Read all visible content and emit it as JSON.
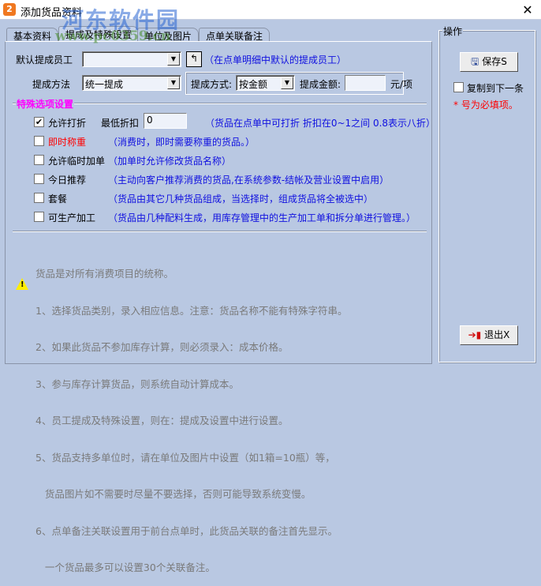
{
  "window": {
    "title": "添加货品资料",
    "close": "✕"
  },
  "watermark": {
    "name": "河东软件园",
    "url": "www.pc0359.cn"
  },
  "tabs": [
    {
      "label": "基本资料"
    },
    {
      "label": "提成及特殊设置"
    },
    {
      "label": "单位及图片"
    },
    {
      "label": "点单关联备注"
    }
  ],
  "commission": {
    "default_employee_label": "默认提成员工",
    "default_employee_value": "",
    "default_employee_hint": "（在点单明细中默认的提成员工）",
    "method_label": "提成方法",
    "method_value": "统一提成",
    "mode_label": "提成方式:",
    "mode_value": "按金额",
    "amount_label": "提成金额:",
    "amount_value": "",
    "amount_unit": "元/项"
  },
  "special": {
    "title": "特殊选项设置",
    "min_discount_label": "最低折扣",
    "min_discount_value": "0",
    "options": [
      {
        "label": "允许打折",
        "checked": true,
        "hint": "（货品在点单中可打折 折扣在0~1之间 0.8表示八折）"
      },
      {
        "label": "即时称重",
        "checked": false,
        "hint": "（消费时，即时需要称重的货品。）"
      },
      {
        "label": "允许临时加单",
        "checked": false,
        "hint": "（加单时允许修改货品名称）"
      },
      {
        "label": "今日推荐",
        "checked": false,
        "hint": "（主动向客户推荐消费的货品,在系统参数-结帐及营业设置中启用）"
      },
      {
        "label": "套餐",
        "checked": false,
        "hint": "（货品由其它几种货品组成，当选择时，组成货品将全被选中）"
      },
      {
        "label": "可生产加工",
        "checked": false,
        "hint": "（货品由几种配料生成，用库存管理中的生产加工单和拆分单进行管理。）"
      }
    ]
  },
  "notes": [
    "货品是对所有消费项目的统称。",
    "1、选择货品类别，录入相应信息。注意：货品名称不能有特殊字符串。",
    "2、如果此货品不参加库存计算，则必须录入：成本价格。",
    "3、参与库存计算货品，则系统自动计算成本。",
    "4、员工提成及特殊设置，则在：提成及设置中进行设置。",
    "5、货品支持多单位时，请在单位及图片中设置（如1箱=10瓶）等，",
    "   货品图片如不需要时尽量不要选择，否则可能导致系统变慢。",
    "6、点单备注关联设置用于前台点单时，此货品关联的备注首先显示。",
    "   一个货品最多可以设置30个关联备注。"
  ],
  "actions": {
    "title": "操作",
    "save": "保存S",
    "copy_next": "复制到下一条",
    "required_note": "* 号为必填项。",
    "exit": "退出X"
  }
}
